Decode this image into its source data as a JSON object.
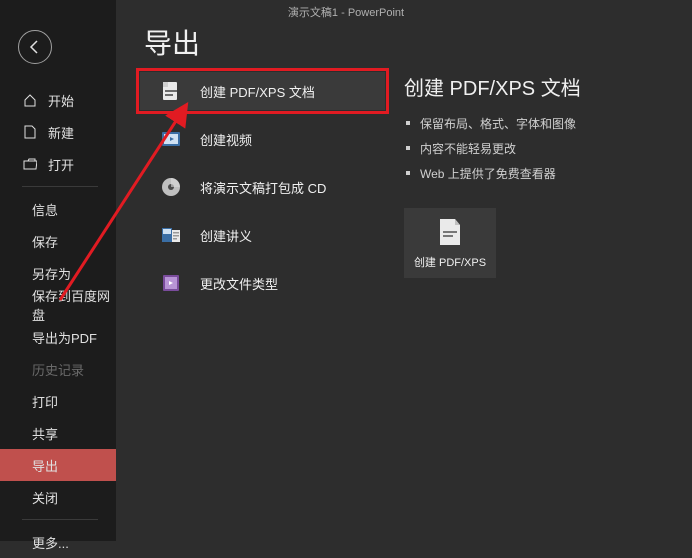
{
  "titlebar": "演示文稿1 - PowerPoint",
  "pageTitle": "导出",
  "sidebar": {
    "top": [
      {
        "icon": "⌂",
        "label": "开始"
      },
      {
        "icon": "🗎",
        "label": "新建"
      },
      {
        "icon": "📂",
        "label": "打开"
      }
    ],
    "main": [
      {
        "label": "信息"
      },
      {
        "label": "保存"
      },
      {
        "label": "另存为"
      },
      {
        "label": "保存到百度网盘"
      },
      {
        "label": "导出为PDF"
      },
      {
        "label": "历史记录",
        "disabled": true
      },
      {
        "label": "打印"
      },
      {
        "label": "共享"
      },
      {
        "label": "导出",
        "active": true
      },
      {
        "label": "关闭"
      }
    ],
    "footer": {
      "label": "更多..."
    }
  },
  "exportOptions": [
    {
      "label": "创建 PDF/XPS 文档",
      "selected": true,
      "highlight": true
    },
    {
      "label": "创建视频"
    },
    {
      "label": "将演示文稿打包成 CD"
    },
    {
      "label": "创建讲义"
    },
    {
      "label": "更改文件类型"
    }
  ],
  "detail": {
    "title": "创建 PDF/XPS 文档",
    "bullets": [
      "保留布局、格式、字体和图像",
      "内容不能轻易更改",
      "Web 上提供了免费查看器"
    ],
    "button": "创建 PDF/XPS"
  }
}
